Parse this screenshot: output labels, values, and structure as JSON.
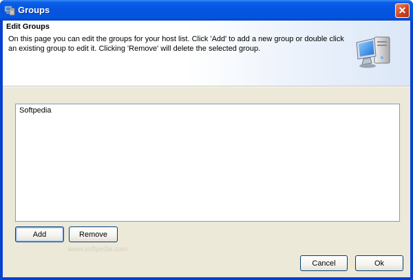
{
  "window": {
    "title": "Groups",
    "close_symbol": "✕"
  },
  "header": {
    "title": "Edit Groups",
    "description": "On this page you can edit the groups for your host list. Click 'Add' to add a new group or double click an existing group to edit it. Clicking 'Remove' will delete the selected group.",
    "icon": "computer-icon"
  },
  "groups_list": {
    "items": [
      "Softpedia"
    ]
  },
  "buttons": {
    "add": "Add",
    "remove": "Remove",
    "cancel": "Cancel",
    "ok": "Ok"
  },
  "watermark": "www.softpedia.com",
  "colors": {
    "titlebar": "#0553e1",
    "dialog_bg": "#ece9d8",
    "list_border": "#7f9db9",
    "button_border": "#003c74",
    "close_button": "#c9431e"
  }
}
